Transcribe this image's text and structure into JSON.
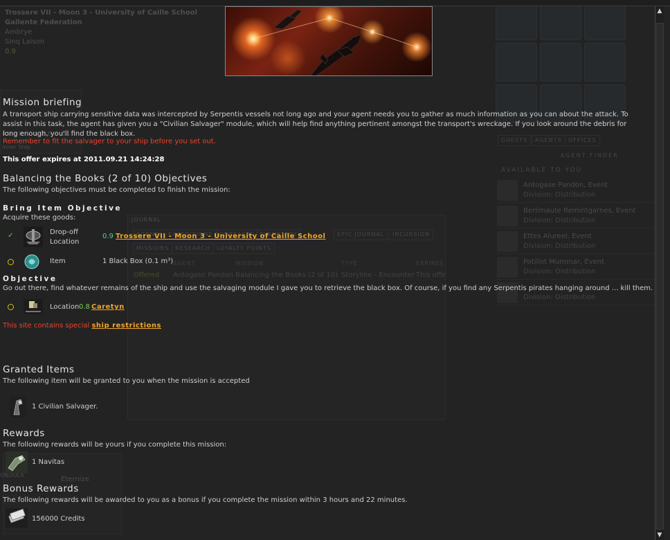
{
  "location": {
    "station": "Trossere VII - Moon 3 - University of Caille School",
    "faction": "Gallente Federation",
    "constellation": "Ambrye",
    "region": "Sinq Laison",
    "security": "0.9"
  },
  "background": {
    "room_label": "ROOM : SIZE : SLI",
    "inner_label": "Inner Ship",
    "tabs_right": [
      "GUESTS",
      "AGENTS",
      "OFFICES"
    ],
    "agent_finder": "AGENT FINDER",
    "available_heading": "AVAILABLE TO YOU",
    "agents": [
      {
        "name": "Antogase Pandon, Event",
        "division": "Division: Distribution"
      },
      {
        "name": "Berlimaute Remintgarnes, Event",
        "division": "Division: Distribution"
      },
      {
        "name": "Ettes Alureel, Event",
        "division": "Division: Distribution"
      },
      {
        "name": "Potillot Mummar, Event",
        "division": "Division: Distribution"
      },
      {
        "name": "",
        "division": "Division: Distribution"
      }
    ],
    "journal_title": "JOURNAL",
    "journal_tabs_row1": [
      "AGENTS",
      "EXPEDITIONS",
      "CONTRACTS",
      "PLANETARY",
      "EPIC JOURNAL",
      "INCURSION"
    ],
    "journal_tabs_row2": [
      "MISSIONS",
      "RESEARCH",
      "LOYALTY POINTS"
    ],
    "journal_columns": [
      "AGENT",
      "MISSION",
      "TYPE",
      "EXPIRES"
    ],
    "journal_row": {
      "state": "Offered",
      "agent": "Antogase Pandon",
      "mission": "Balancing the Books (2 of 10)",
      "type": "Storyline - Encounter",
      "expires": "This offe"
    },
    "undock": "UNDOCK",
    "chat_name": "Eternize"
  },
  "briefing": {
    "title": "Mission briefing",
    "text": "A transport ship carrying sensitive data was intercepted by Serpentis vessels not long ago and your agent needs you to gather as much information as you can about the attack. To assist in this task, the agent has given you a \"Civilian Salvager\" module, which will help find anything pertinent amongst the transport's wreckage. If you look around the debris for long enough, you'll find the black box.",
    "warning": "Remember to fit the salvager to your ship before you set out.",
    "expires_label": "This offer expires at 2011.09.21 14:24:28"
  },
  "objectives": {
    "title": "Balancing the Books (2 of 10) Objectives",
    "subtitle": "The following objectives must be completed to finish the mission:",
    "bring_item_heading": "Bring Item Objective",
    "acquire_text": "Acquire these goods:",
    "dropoff_label_1": "Drop-off",
    "dropoff_label_2": "Location",
    "dropoff_security": "0.9",
    "dropoff_location": "Trossere VII - Moon 3 - University of Caille School",
    "item_label": "Item",
    "item_value": "1 Black Box (0.1 m³)",
    "objective_heading": "Objective",
    "objective_text": "Go out there, find whatever remains of the ship and use the salvaging module I gave you to retrieve the black box. Of course, if you find any Serpentis pirates hanging around ... kill them.",
    "location_label": "Location",
    "location_security": "0.8",
    "location_value": "Caretyn",
    "restriction_prefix": "This site contains special",
    "restriction_link": "ship restrictions"
  },
  "granted": {
    "title": "Granted Items",
    "subtitle": "The following item will be granted to you when the mission is accepted",
    "item": "1  Civilian Salvager."
  },
  "rewards": {
    "title": "Rewards",
    "subtitle": "The following rewards will be yours if you complete this mission:",
    "item": "1  Navitas"
  },
  "bonus": {
    "title": "Bonus Rewards",
    "subtitle": "The following rewards will be awarded to you as a bonus if you complete the mission within 3 hours and 22 minutes.",
    "item": "156000  Credits"
  },
  "colors": {
    "link": "#f3a62c",
    "warning": "#e8452f",
    "security_09": "#56d296",
    "security_08": "#7bd05a",
    "incomplete_ring": "#e0c000",
    "complete_check": "#5fd44c"
  }
}
